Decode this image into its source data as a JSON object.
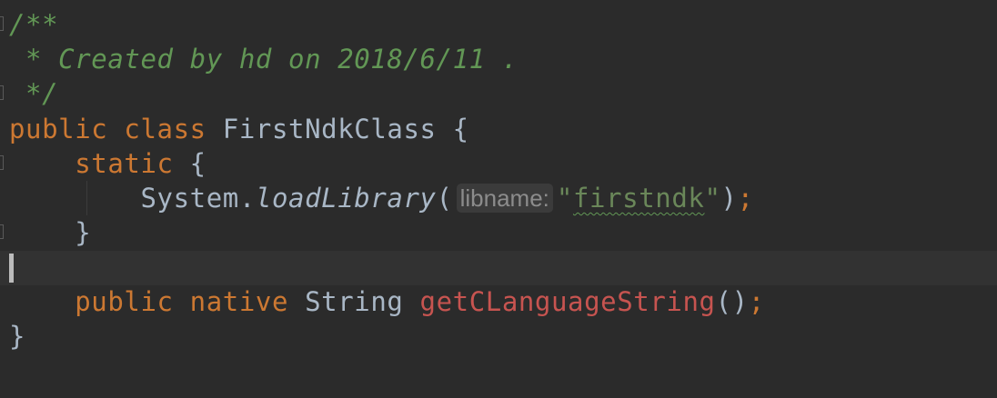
{
  "editor": {
    "language": "java",
    "lines": {
      "l1": {
        "doc": "/**"
      },
      "l2": {
        "doc": " * Created by hd on 2018/6/11 ."
      },
      "l3": {
        "doc": " */"
      },
      "l4": {
        "kw1": "public",
        "kw2": "class",
        "name": "FirstNdkClass",
        "brace": "{"
      },
      "l5": {
        "kw": "static",
        "brace": "{"
      },
      "l6": {
        "recv": "System.",
        "method": "loadLibrary",
        "open": "(",
        "hint": "libname:",
        "q1": "\"",
        "arg": "firstndk",
        "q2": "\"",
        "close": ")",
        "semi": ";"
      },
      "l7": {
        "brace": "}"
      },
      "l9": {
        "kw1": "public",
        "kw2": "native",
        "type": "String",
        "method": "getCLanguageString",
        "parens": "()",
        "semi": ";"
      },
      "l10": {
        "brace": "}"
      }
    },
    "colors": {
      "background": "#2b2b2b",
      "keyword": "#cc7832",
      "doc_comment": "#629755",
      "string": "#6a8759",
      "native_method": "#c75450",
      "text": "#a9b7c6"
    }
  }
}
